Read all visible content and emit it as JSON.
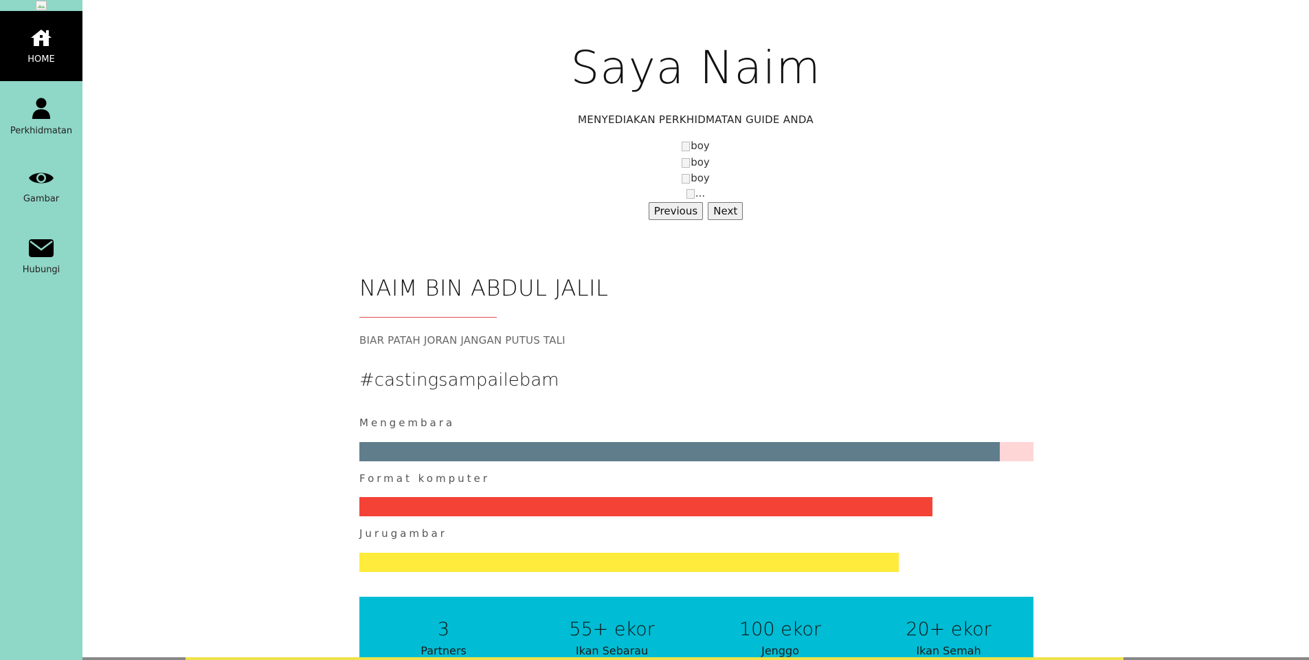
{
  "sidebar": {
    "items": [
      {
        "label": "HOME",
        "icon": "home-icon",
        "active": true
      },
      {
        "label": "Perkhidmatan",
        "icon": "user-icon",
        "active": false
      },
      {
        "label": "Gambar",
        "icon": "eye-icon",
        "active": false
      },
      {
        "label": "Hubungi",
        "icon": "envelope-icon",
        "active": false
      }
    ]
  },
  "hero": {
    "title": "Saya Naim",
    "subtitle": "MENYEDIAKAN PERKHIDMATAN GUIDE ANDA"
  },
  "carousel": {
    "alts": [
      "boy",
      "boy",
      "boy",
      "..."
    ],
    "previous_label": "Previous",
    "next_label": "Next"
  },
  "about": {
    "name": "NAIM BIN ABDUL JALIL",
    "motto": "BIAR PATAH JORAN JANGAN PUTUS TALI",
    "hashtag": "#castingsampailebam"
  },
  "skills": [
    {
      "label": "Mengembara",
      "percent": 95,
      "color": "#607d8b",
      "track": "#ffd6d6"
    },
    {
      "label": "Format komputer",
      "percent": 85,
      "color": "#f44336",
      "track": "#ffffff"
    },
    {
      "label": "Jurugambar",
      "percent": 80,
      "color": "#ffeb3b",
      "track": "#ffffff"
    }
  ],
  "stats": [
    {
      "value": "3",
      "label": "Partners"
    },
    {
      "value": "55+ ekor",
      "label": "Ikan Sebarau"
    },
    {
      "value": "100 ekor",
      "label": "Jenggo"
    },
    {
      "value": "20+ ekor",
      "label": "Ikan Semah"
    }
  ],
  "colors": {
    "sidebar_bg": "#8fd7c7",
    "active_nav_bg": "#000000",
    "stats_bg": "#00bcd4",
    "accent_rule": "#e34a4a"
  }
}
